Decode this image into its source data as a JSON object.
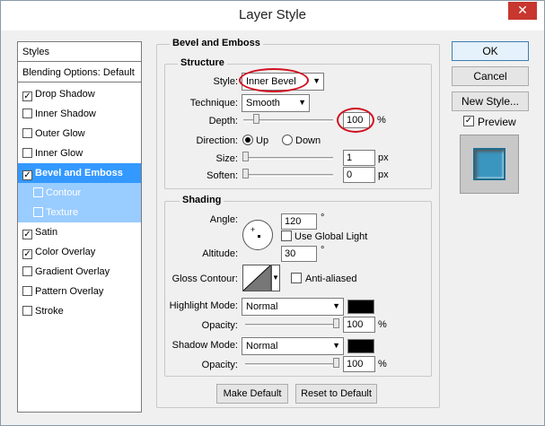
{
  "window": {
    "title": "Layer Style",
    "close_glyph": "✕"
  },
  "styles_list": {
    "header": "Styles",
    "blending": "Blending Options: Default",
    "items": [
      {
        "label": "Drop Shadow",
        "checked": true
      },
      {
        "label": "Inner Shadow",
        "checked": false
      },
      {
        "label": "Outer Glow",
        "checked": false
      },
      {
        "label": "Inner Glow",
        "checked": false
      },
      {
        "label": "Bevel and Emboss",
        "checked": true
      },
      {
        "label": "Contour",
        "checked": false
      },
      {
        "label": "Texture",
        "checked": false
      },
      {
        "label": "Satin",
        "checked": true
      },
      {
        "label": "Color Overlay",
        "checked": true
      },
      {
        "label": "Gradient Overlay",
        "checked": false
      },
      {
        "label": "Pattern Overlay",
        "checked": false
      },
      {
        "label": "Stroke",
        "checked": false
      }
    ]
  },
  "bevel": {
    "group_title": "Bevel and Emboss",
    "structure_title": "Structure",
    "style_label": "Style:",
    "style_value": "Inner Bevel",
    "technique_label": "Technique:",
    "technique_value": "Smooth",
    "depth_label": "Depth:",
    "depth_value": "100",
    "depth_unit": "%",
    "direction_label": "Direction:",
    "direction_up": "Up",
    "direction_down": "Down",
    "size_label": "Size:",
    "size_value": "1",
    "size_unit": "px",
    "soften_label": "Soften:",
    "soften_value": "0",
    "soften_unit": "px"
  },
  "shading": {
    "title": "Shading",
    "angle_label": "Angle:",
    "angle_value": "120",
    "angle_unit": "°",
    "global_light_label": "Use Global Light",
    "altitude_label": "Altitude:",
    "altitude_value": "30",
    "altitude_unit": "°",
    "gloss_label": "Gloss Contour:",
    "antialiased_label": "Anti-aliased",
    "highlight_mode_label": "Highlight Mode:",
    "highlight_mode_value": "Normal",
    "highlight_color": "#000000",
    "opacity_label": "Opacity:",
    "highlight_opacity": "100",
    "opacity_unit": "%",
    "shadow_mode_label": "Shadow Mode:",
    "shadow_mode_value": "Normal",
    "shadow_color": "#000000",
    "shadow_opacity": "100"
  },
  "buttons": {
    "make_default": "Make Default",
    "reset_default": "Reset to Default",
    "ok": "OK",
    "cancel": "Cancel",
    "new_style": "New Style...",
    "preview": "Preview"
  },
  "colors": {
    "selection": "#3399ff",
    "annotation": "#d01020",
    "preview_fill": "#3a95bf"
  }
}
